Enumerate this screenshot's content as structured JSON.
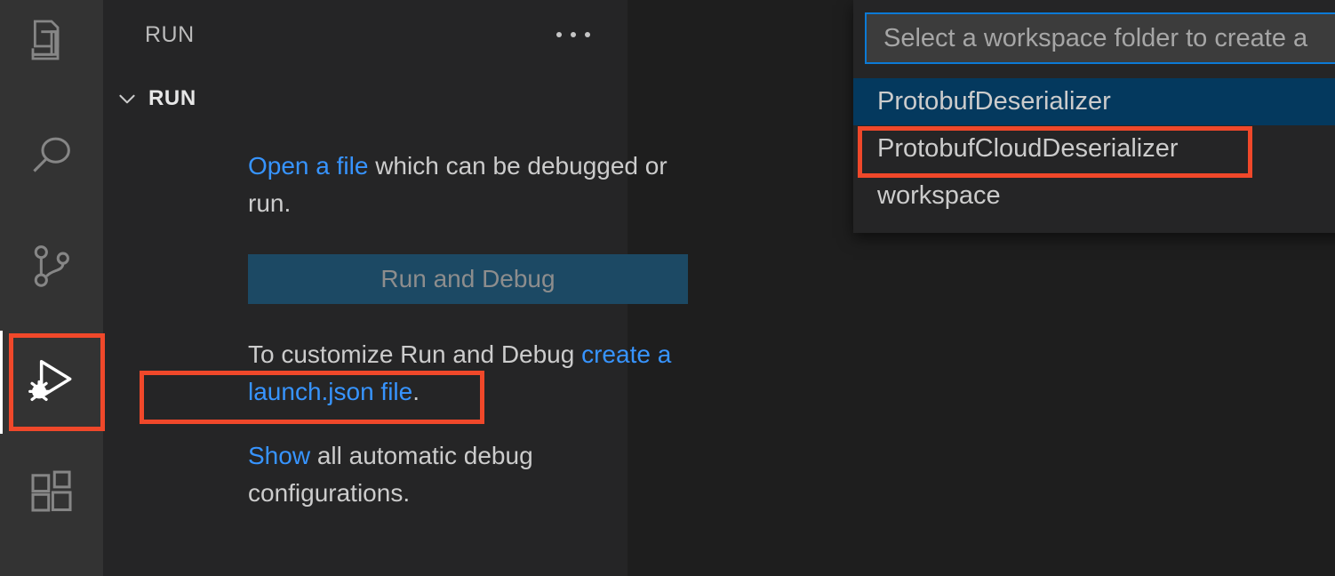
{
  "activity_bar": {
    "items": [
      {
        "name": "explorer",
        "icon": "files-icon",
        "active": false
      },
      {
        "name": "search",
        "icon": "search-icon",
        "active": false
      },
      {
        "name": "source-control",
        "icon": "source-control-icon",
        "active": false
      },
      {
        "name": "run-and-debug",
        "icon": "run-and-debug-icon",
        "active": true
      },
      {
        "name": "extensions",
        "icon": "extensions-icon",
        "active": false
      }
    ]
  },
  "sidebar": {
    "title": "RUN",
    "more_actions_icon": "ellipsis-icon",
    "section": {
      "label": "RUN",
      "chevron_icon": "chevron-down-icon"
    },
    "welcome": {
      "open_file_link": "Open a file",
      "open_file_rest": " which can be debugged or run."
    },
    "run_debug_button": "Run and Debug",
    "customize": {
      "prefix": "To customize Run and Debug ",
      "link": "create a launch.json file",
      "suffix": "."
    },
    "show": {
      "link": "Show",
      "rest": " all automatic debug configurations."
    }
  },
  "quick_pick": {
    "placeholder": "Select a workspace folder to create a",
    "items": [
      {
        "label": "ProtobufDeserializer",
        "selected": true
      },
      {
        "label": "ProtobufCloudDeserializer",
        "selected": false
      },
      {
        "label": "workspace",
        "selected": false
      }
    ]
  },
  "colors": {
    "activity_bar_bg": "#333333",
    "sidebar_bg": "#252526",
    "editor_bg": "#1e1e1e",
    "link": "#3794ff",
    "button_bg": "#1c4964",
    "selected_row": "#04395e",
    "focus_border": "#0c7ad6",
    "annotation": "#f0482a",
    "active_indicator": "#ffffff"
  }
}
